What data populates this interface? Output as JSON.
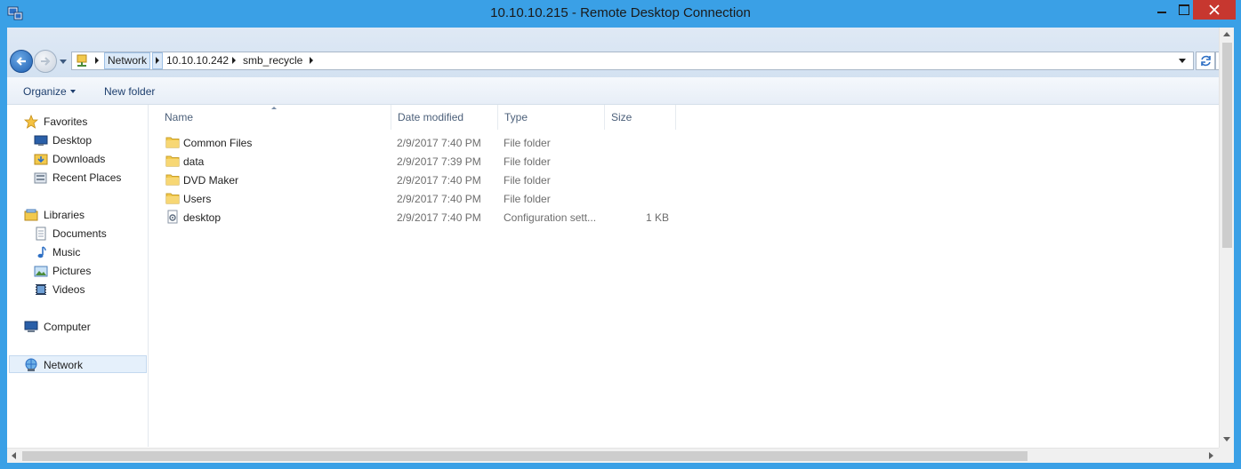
{
  "window": {
    "title": "10.10.10.215 - Remote Desktop Connection",
    "accent": "#3aa0e6",
    "close_color": "#c7372f"
  },
  "address": {
    "crumbs": [
      "Network",
      "10.10.10.242",
      "smb_recycle"
    ]
  },
  "commandbar": {
    "organize": "Organize",
    "new_folder": "New folder"
  },
  "nav": {
    "favorites": {
      "label": "Favorites",
      "icon": "star-icon"
    },
    "favorites_items": [
      {
        "label": "Desktop",
        "icon": "desktop-icon"
      },
      {
        "label": "Downloads",
        "icon": "downloads-folder-icon"
      },
      {
        "label": "Recent Places",
        "icon": "recent-places-icon"
      }
    ],
    "libraries": {
      "label": "Libraries",
      "icon": "libraries-icon"
    },
    "libraries_items": [
      {
        "label": "Documents",
        "icon": "documents-icon"
      },
      {
        "label": "Music",
        "icon": "music-icon"
      },
      {
        "label": "Pictures",
        "icon": "pictures-icon"
      },
      {
        "label": "Videos",
        "icon": "videos-icon"
      }
    ],
    "computer": {
      "label": "Computer",
      "icon": "computer-icon"
    },
    "network": {
      "label": "Network",
      "icon": "network-icon"
    }
  },
  "columns": {
    "name": "Name",
    "date": "Date modified",
    "type": "Type",
    "size": "Size"
  },
  "files": [
    {
      "name": "Common Files",
      "date": "2/9/2017 7:40 PM",
      "type": "File folder",
      "size": "",
      "icon": "folder-icon"
    },
    {
      "name": "data",
      "date": "2/9/2017 7:39 PM",
      "type": "File folder",
      "size": "",
      "icon": "folder-icon"
    },
    {
      "name": "DVD Maker",
      "date": "2/9/2017 7:40 PM",
      "type": "File folder",
      "size": "",
      "icon": "folder-icon"
    },
    {
      "name": "Users",
      "date": "2/9/2017 7:40 PM",
      "type": "File folder",
      "size": "",
      "icon": "folder-icon"
    },
    {
      "name": "desktop",
      "date": "2/9/2017 7:40 PM",
      "type": "Configuration sett...",
      "size": "1 KB",
      "icon": "config-file-icon"
    }
  ]
}
